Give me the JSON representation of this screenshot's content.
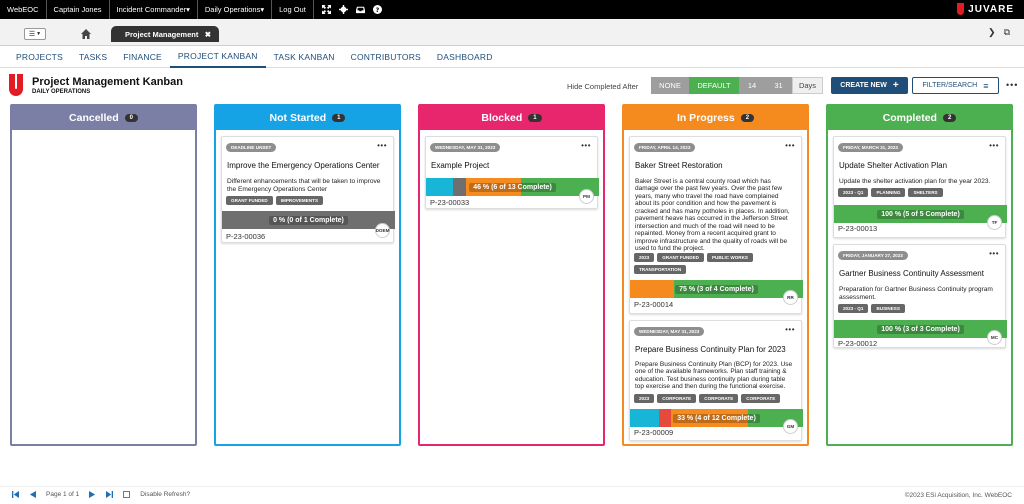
{
  "topbar": {
    "items": [
      "WebEOC",
      "Captain Jones",
      "Incident Commander▾",
      "Daily Operations▾",
      "Log Out"
    ],
    "brand": "JUVARE"
  },
  "tabstrip": {
    "doc_tab": "Project Management",
    "close": "✖"
  },
  "nav": {
    "items": [
      "PROJECTS",
      "TASKS",
      "FINANCE",
      "PROJECT KANBAN",
      "TASK KANBAN",
      "CONTRIBUTORS",
      "DASHBOARD"
    ],
    "active": 3
  },
  "header": {
    "title": "Project Management Kanban",
    "subtitle": "DAILY OPERATIONS",
    "hide_label": "Hide Completed After",
    "segments": [
      "NONE",
      "DEFAULT",
      "14",
      "31",
      "Days"
    ],
    "create": "CREATE NEW",
    "filter": "FILTER/SEARCH"
  },
  "colors": {
    "cancelled": "#7b7fa6",
    "not_started": "#16a3e6",
    "blocked": "#e8266d",
    "in_progress": "#f58a1f",
    "completed": "#4caf50"
  },
  "columns": [
    {
      "title": "Cancelled",
      "count": "0",
      "cards": []
    },
    {
      "title": "Not Started",
      "count": "1",
      "cards": [
        {
          "date": "DEADLINE UNSET",
          "title": "Improve the Emergency Operations Center",
          "desc": "Different enhancements that will be taken to improve the Emergency Operations Center",
          "tags": [
            "GRANT FUNDED",
            "IMPROVEMENTS"
          ],
          "progress": "0 % (0 of 1 Complete)",
          "percent": 0,
          "id": "P-23-00036",
          "avatar": "DOEM"
        }
      ]
    },
    {
      "title": "Blocked",
      "count": "1",
      "cards": [
        {
          "date": "WEDNESDAY, MAY 31, 2023",
          "title": "Example Project",
          "desc": "",
          "tags": [],
          "progress": "46 % (6 of 13 Complete)",
          "percent": 46,
          "id": "P-23-00033",
          "avatar": "PM"
        }
      ]
    },
    {
      "title": "In Progress",
      "count": "2",
      "cards": [
        {
          "date": "FRIDAY, APRIL 14, 2023",
          "title": "Baker Street Restoration",
          "desc": "Baker Street is a central county road which has damage over the past few years. Over the past few years, many who travel the road have complained about its poor condition and how the pavement is cracked and has many potholes in places. In addition, pavement heave has occurred in the Jefferson Street intersection and much of the road will need to be repainted. Money from a recent acquired grant to improve infrastructure and the quality of roads will be used to fund the project.",
          "tags": [
            "2023",
            "GRANT FUNDED",
            "PUBLIC WORKS",
            "TRANSPORTATION"
          ],
          "progress": "75 % (3 of 4 Complete)",
          "percent": 75,
          "id": "P-23-00014",
          "avatar": "RR"
        },
        {
          "date": "WEDNESDAY, MAY 31, 2023",
          "title": "Prepare Business Continuity Plan for 2023",
          "desc": "Prepare Business Continuity Plan (BCP) for 2023. Use one of the available frameworks. Plan staff training & education. Test business continuity plan during table top exercise and then during the functional exercise.",
          "tags": [
            "2023",
            "CORPORATE",
            "CORPORATE",
            "CORPORATE"
          ],
          "progress": "33 % (4 of 12 Complete)",
          "percent": 33,
          "id": "P-23-00009",
          "avatar": "GM"
        }
      ]
    },
    {
      "title": "Completed",
      "count": "2",
      "cards": [
        {
          "date": "FRIDAY, MARCH 31, 2023",
          "title": "Update Shelter Activation Plan",
          "desc": "Update the shelter activation plan for the year 2023.",
          "tags": [
            "2023 - Q1",
            "PLANNING",
            "SHELTERS"
          ],
          "progress": "100 % (5 of 5 Complete)",
          "percent": 100,
          "id": "P-23-00013",
          "avatar": "TF"
        },
        {
          "date": "FRIDAY, JANUARY 27, 2023",
          "title": "Gartner Business Continuity Assessment",
          "desc": "Preparation for Gartner Business Continuity program assessment.",
          "tags": [
            "2023 - Q1",
            "BUSINESS"
          ],
          "progress": "100 % (3 of 3 Complete)",
          "percent": 100,
          "id": "P-23-00012",
          "avatar": "MC"
        }
      ]
    }
  ],
  "footer": {
    "page": "Page 1 of 1",
    "disable_refresh": "Disable Refresh?",
    "copyright": "©2023 ESi Acquisition, Inc. WebEOC"
  }
}
